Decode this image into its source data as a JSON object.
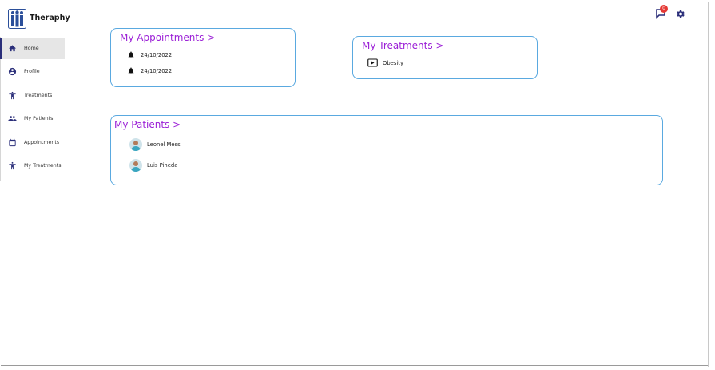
{
  "app": {
    "brand": "Theraphy"
  },
  "header": {
    "notification_count": "0"
  },
  "sidebar": {
    "items": [
      {
        "label": "Home",
        "icon": "home-icon",
        "active": true
      },
      {
        "label": "Profile",
        "icon": "account-circle-icon"
      },
      {
        "label": "Treatments",
        "icon": "accessibility-icon"
      },
      {
        "label": "My Patients",
        "icon": "people-icon"
      },
      {
        "label": "Appointments",
        "icon": "calendar-icon"
      },
      {
        "label": "My Treatments",
        "icon": "accessibility-icon"
      }
    ]
  },
  "appointments": {
    "title": "My Appointments >",
    "items": [
      {
        "date": "24/10/2022",
        "icon": "bell-icon"
      },
      {
        "date": "24/10/2022",
        "icon": "bell-icon"
      }
    ]
  },
  "treatments": {
    "title": "My Treatments >",
    "items": [
      {
        "name": "Obesity",
        "icon": "video-play-icon"
      }
    ]
  },
  "patients": {
    "title": "My Patients >",
    "items": [
      {
        "name": "Leonel Messi",
        "icon": "patient-avatar"
      },
      {
        "name": "Luis Pineda",
        "icon": "patient-avatar"
      }
    ]
  },
  "colors": {
    "accent_title": "#9b1fd6",
    "card_border": "#5aa9e0",
    "nav_icon": "#2b2f7a",
    "badge": "#e53935"
  }
}
